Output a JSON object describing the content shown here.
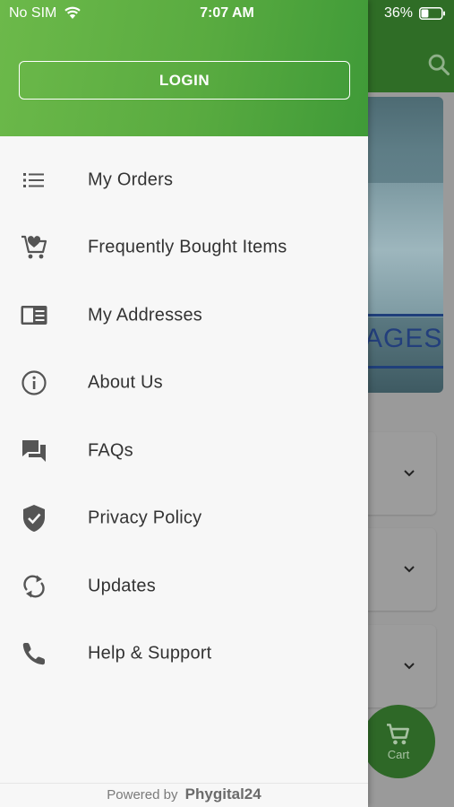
{
  "status_bar": {
    "carrier": "No SIM",
    "time": "7:07 AM",
    "battery_percent": "36%",
    "battery_level": 0.36
  },
  "background": {
    "banner_text": "AGES",
    "cart_label": "Cart",
    "colors": {
      "appbar": "#2f6d26",
      "cart": "#2e6827"
    }
  },
  "drawer": {
    "login_label": "LOGIN",
    "header_color": "#5aac42",
    "items": [
      {
        "label": "My Orders",
        "icon": "list-icon"
      },
      {
        "label": "Frequently Bought Items",
        "icon": "cart-heart-icon"
      },
      {
        "label": "My Addresses",
        "icon": "address-card-icon"
      },
      {
        "label": "About Us",
        "icon": "info-icon"
      },
      {
        "label": "FAQs",
        "icon": "chat-bubbles-icon"
      },
      {
        "label": "Privacy Policy",
        "icon": "shield-check-icon"
      },
      {
        "label": "Updates",
        "icon": "sync-icon"
      },
      {
        "label": "Help & Support",
        "icon": "phone-icon"
      }
    ],
    "footer": {
      "prefix": "Powered by",
      "brand": "Phygital24"
    }
  }
}
